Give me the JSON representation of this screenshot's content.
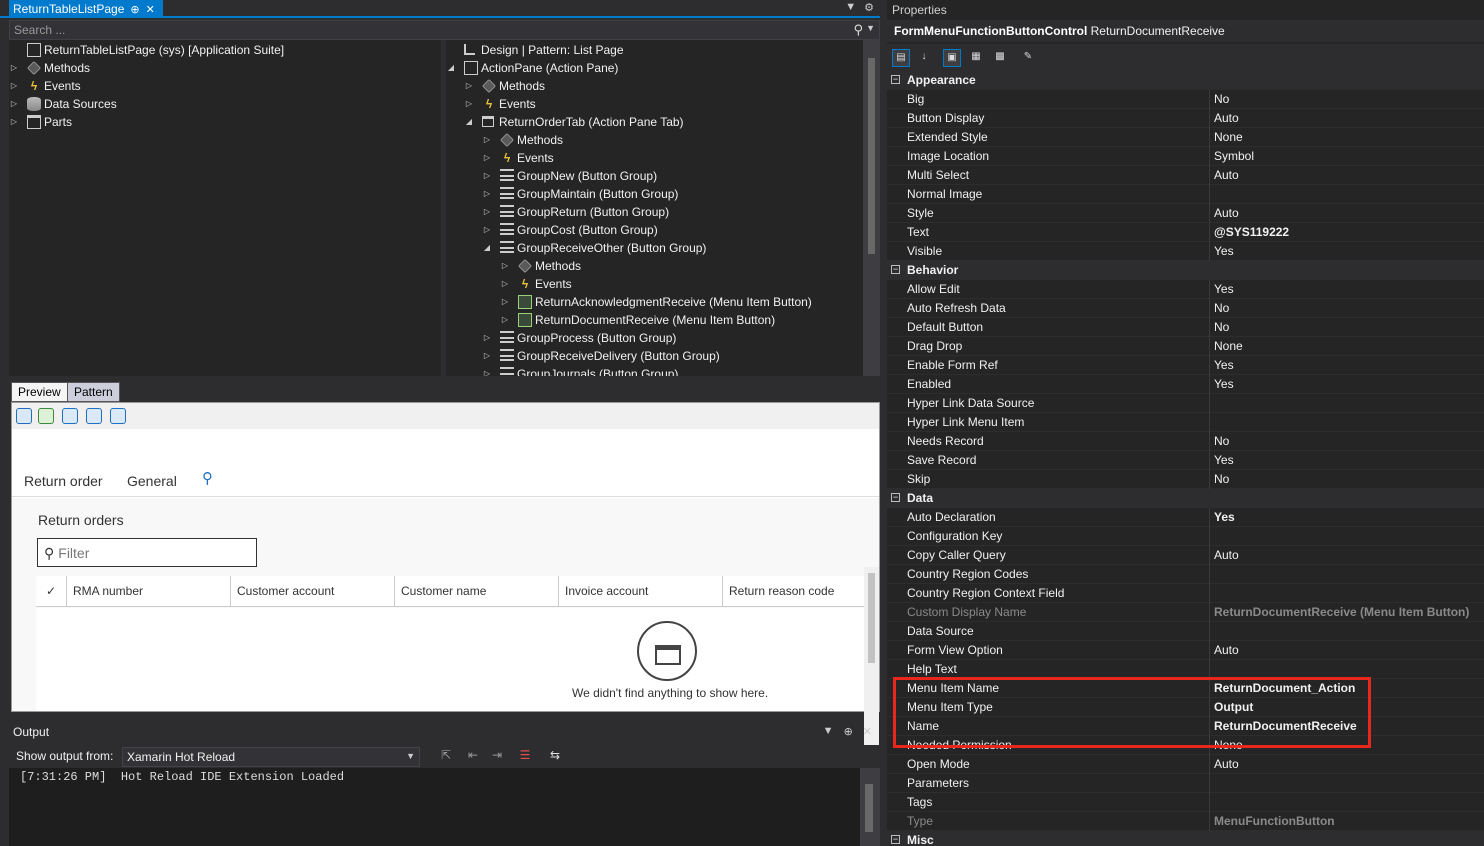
{
  "document_tab": {
    "title": "ReturnTableListPage",
    "pin_glyph": "⊕",
    "close_glyph": "✕"
  },
  "search": {
    "placeholder": "Search ..."
  },
  "left_tree": [
    {
      "label": "ReturnTableListPage (sys) [Application Suite]",
      "icon": "form-icon",
      "expander": ""
    },
    {
      "label": "Methods",
      "icon": "methods-icon",
      "expander": "▷"
    },
    {
      "label": "Events",
      "icon": "events-icon",
      "expander": "▷"
    },
    {
      "label": "Data Sources",
      "icon": "datasource-icon",
      "expander": "▷"
    },
    {
      "label": "Parts",
      "icon": "parts-icon",
      "expander": "▷"
    }
  ],
  "right_tree": [
    {
      "label": "Design | Pattern: List Page",
      "icon": "design-icon",
      "expander": ""
    },
    {
      "label": "ActionPane (Action Pane)",
      "icon": "actionpane-icon",
      "expander": "◢"
    },
    {
      "label": "Methods",
      "icon": "methods-icon",
      "expander": "▷"
    },
    {
      "label": "Events",
      "icon": "events-icon",
      "expander": "▷"
    },
    {
      "label": "ReturnOrderTab (Action Pane Tab)",
      "icon": "tab-icon",
      "expander": "◢"
    },
    {
      "label": "Methods",
      "icon": "methods-icon",
      "expander": "▷"
    },
    {
      "label": "Events",
      "icon": "events-icon",
      "expander": "▷"
    },
    {
      "label": "GroupNew (Button Group)",
      "icon": "buttongroup-icon",
      "expander": "▷"
    },
    {
      "label": "GroupMaintain (Button Group)",
      "icon": "buttongroup-icon",
      "expander": "▷"
    },
    {
      "label": "GroupReturn (Button Group)",
      "icon": "buttongroup-icon",
      "expander": "▷"
    },
    {
      "label": "GroupCost (Button Group)",
      "icon": "buttongroup-icon",
      "expander": "▷"
    },
    {
      "label": "GroupReceiveOther (Button Group)",
      "icon": "buttongroup-icon",
      "expander": "◢"
    },
    {
      "label": "Methods",
      "icon": "methods-icon",
      "expander": "▷"
    },
    {
      "label": "Events",
      "icon": "events-icon",
      "expander": "▷"
    },
    {
      "label": "ReturnAcknowledgmentReceive (Menu Item Button)",
      "icon": "menuitembutton-icon",
      "expander": "▷"
    },
    {
      "label": "ReturnDocumentReceive (Menu Item Button)",
      "icon": "menuitembutton-icon",
      "expander": "▷"
    },
    {
      "label": "GroupProcess (Button Group)",
      "icon": "buttongroup-icon",
      "expander": "▷"
    },
    {
      "label": "GroupReceiveDelivery (Button Group)",
      "icon": "buttongroup-icon",
      "expander": "▷"
    },
    {
      "label": "GroupJournals (Button Group)",
      "icon": "buttongroup-icon",
      "expander": "▷"
    }
  ],
  "preview": {
    "tabs": [
      "Preview",
      "Pattern"
    ],
    "nav_items": [
      "Return order",
      "General"
    ],
    "section_title": "Return orders",
    "filter_placeholder": "Filter",
    "columns": [
      "RMA number",
      "Customer account",
      "Customer name",
      "Invoice account",
      "Return reason code"
    ],
    "empty_message": "We didn't find anything to show here."
  },
  "output": {
    "title": "Output",
    "show_from_label": "Show output from:",
    "source": "Xamarin Hot Reload",
    "log": "[7:31:26 PM]  Hot Reload IDE Extension Loaded"
  },
  "properties": {
    "title": "Properties",
    "object_type": "FormMenuFunctionButtonControl",
    "object_name": "ReturnDocumentReceive",
    "rows": [
      {
        "type": "cat",
        "name": "Appearance"
      },
      {
        "name": "Big",
        "value": "No"
      },
      {
        "name": "Button Display",
        "value": "Auto"
      },
      {
        "name": "Extended Style",
        "value": "None"
      },
      {
        "name": "Image Location",
        "value": "Symbol"
      },
      {
        "name": "Multi Select",
        "value": "Auto"
      },
      {
        "name": "Normal Image",
        "value": ""
      },
      {
        "name": "Style",
        "value": "Auto"
      },
      {
        "name": "Text",
        "value": "@SYS119222",
        "bold": true
      },
      {
        "name": "Visible",
        "value": "Yes"
      },
      {
        "type": "cat",
        "name": "Behavior"
      },
      {
        "name": "Allow Edit",
        "value": "Yes"
      },
      {
        "name": "Auto Refresh Data",
        "value": "No"
      },
      {
        "name": "Default Button",
        "value": "No"
      },
      {
        "name": "Drag Drop",
        "value": "None"
      },
      {
        "name": "Enable Form Ref",
        "value": "Yes"
      },
      {
        "name": "Enabled",
        "value": "Yes"
      },
      {
        "name": "Hyper Link Data Source",
        "value": ""
      },
      {
        "name": "Hyper Link Menu Item",
        "value": ""
      },
      {
        "name": "Needs Record",
        "value": "No"
      },
      {
        "name": "Save Record",
        "value": "Yes"
      },
      {
        "name": "Skip",
        "value": "No"
      },
      {
        "type": "cat",
        "name": "Data"
      },
      {
        "name": "Auto Declaration",
        "value": "Yes",
        "bold": true
      },
      {
        "name": "Configuration Key",
        "value": ""
      },
      {
        "name": "Copy Caller Query",
        "value": "Auto"
      },
      {
        "name": "Country Region Codes",
        "value": ""
      },
      {
        "name": "Country Region Context Field",
        "value": ""
      },
      {
        "name": "Custom Display Name",
        "value": "ReturnDocumentReceive (Menu Item Button)",
        "dim": true,
        "bold": true
      },
      {
        "name": "Data Source",
        "value": ""
      },
      {
        "name": "Form View Option",
        "value": "Auto"
      },
      {
        "name": "Help Text",
        "value": ""
      },
      {
        "name": "Menu Item Name",
        "value": "ReturnDocument_Action",
        "bold": true
      },
      {
        "name": "Menu Item Type",
        "value": "Output",
        "bold": true
      },
      {
        "name": "Name",
        "value": "ReturnDocumentReceive",
        "bold": true
      },
      {
        "name": "Needed Permission",
        "value": "None"
      },
      {
        "name": "Open Mode",
        "value": "Auto"
      },
      {
        "name": "Parameters",
        "value": ""
      },
      {
        "name": "Tags",
        "value": ""
      },
      {
        "name": "Type",
        "value": "MenuFunctionButton",
        "dim": true,
        "bold": true
      },
      {
        "type": "cat",
        "name": "Misc"
      }
    ]
  }
}
